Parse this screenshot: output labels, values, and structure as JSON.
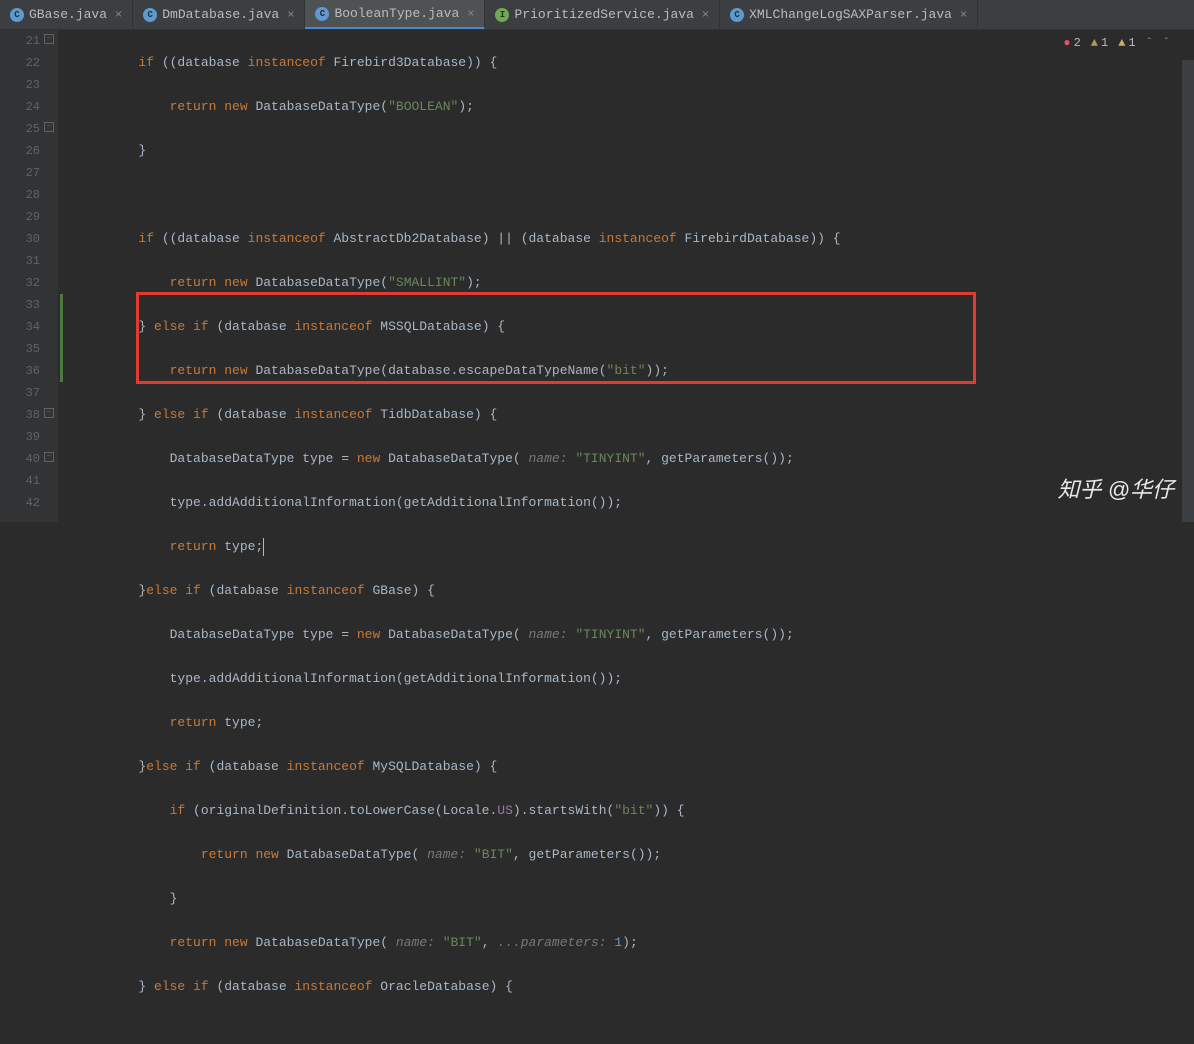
{
  "tabs": [
    {
      "icon": "C",
      "type": "cls",
      "label": "GBase.java",
      "active": false
    },
    {
      "icon": "C",
      "type": "cls",
      "label": "DmDatabase.java",
      "active": false
    },
    {
      "icon": "C",
      "type": "cls",
      "label": "BooleanType.java",
      "active": true
    },
    {
      "icon": "I",
      "type": "intf",
      "label": "PrioritizedService.java",
      "active": false
    },
    {
      "icon": "C",
      "type": "cls",
      "label": "XMLChangeLogSAXParser.java",
      "active": false
    }
  ],
  "lines": [
    {
      "n": "21"
    },
    {
      "n": "22"
    },
    {
      "n": "23"
    },
    {
      "n": "24"
    },
    {
      "n": "25"
    },
    {
      "n": "26"
    },
    {
      "n": "27"
    },
    {
      "n": "28"
    },
    {
      "n": "29"
    },
    {
      "n": "30"
    },
    {
      "n": "31"
    },
    {
      "n": "32"
    },
    {
      "n": "33"
    },
    {
      "n": "34"
    },
    {
      "n": "35"
    },
    {
      "n": "36"
    },
    {
      "n": "37"
    },
    {
      "n": "38"
    },
    {
      "n": "39"
    },
    {
      "n": "40"
    },
    {
      "n": "41"
    },
    {
      "n": "42"
    }
  ],
  "code": {
    "l21a": "        if ((database ",
    "l21kw": "instanceof",
    "l21b": " Firebird3Database)) {",
    "l22a": "            ",
    "l22kw1": "return",
    "l22kw2": " new",
    "l22b": " DatabaseDataType(",
    "l22str": "\"BOOLEAN\"",
    "l22c": ");",
    "l23": "        }",
    "l25a": "        if ((database ",
    "l25kw": "instanceof",
    "l25b": " AbstractDb2Database) || (database ",
    "l25kw2": "instanceof",
    "l25c": " FirebirdDatabase)) {",
    "l26a": "            ",
    "l26kw1": "return",
    "l26kw2": " new",
    "l26b": " DatabaseDataType(",
    "l26str": "\"SMALLINT\"",
    "l26c": ");",
    "l27a": "        } ",
    "l27kw1": "else",
    "l27kw2": " if",
    "l27b": " (database ",
    "l27kw3": "instanceof",
    "l27c": " MSSQLDatabase) {",
    "l28a": "            ",
    "l28kw1": "return",
    "l28kw2": " new",
    "l28b": " DatabaseDataType(database.escapeDataTypeName(",
    "l28str": "\"bit\"",
    "l28c": "));",
    "l29a": "        } ",
    "l29kw1": "else",
    "l29kw2": " if",
    "l29b": " (database ",
    "l29kw3": "instanceof",
    "l29c": " TidbDatabase) {",
    "l30a": "            DatabaseDataType type = ",
    "l30kw": "new",
    "l30b": " DatabaseDataType(",
    "l30hint": " name: ",
    "l30str": "\"TINYINT\"",
    "l30c": ", getParameters());",
    "l31a": "            type.addAdditionalInformation(getAdditionalInformation());",
    "l32a": "            ",
    "l32kw": "return",
    "l32b": " type;",
    "l33a": "        }",
    "l33kw1": "else",
    "l33kw2": " if",
    "l33b": " (database ",
    "l33kw3": "instanceof",
    "l33c": " GBase) {",
    "l34a": "            DatabaseDataType type = ",
    "l34kw": "new",
    "l34b": " DatabaseDataType(",
    "l34hint": " name: ",
    "l34str": "\"TINYINT\"",
    "l34c": ", getParameters());",
    "l35a": "            type.addAdditionalInformation(getAdditionalInformation());",
    "l36a": "            ",
    "l36kw": "return",
    "l36b": " type;",
    "l37a": "        }",
    "l37kw1": "else",
    "l37kw2": " if",
    "l37b": " (database ",
    "l37kw3": "instanceof",
    "l37c": " MySQLDatabase) {",
    "l38a": "            if (originalDefinition.toLowerCase(Locale.",
    "l38fld": "US",
    "l38b": ").startsWith(",
    "l38str": "\"bit\"",
    "l38c": ")) {",
    "l39a": "                ",
    "l39kw1": "return",
    "l39kw2": " new",
    "l39b": " DatabaseDataType(",
    "l39hint": " name: ",
    "l39str": "\"BIT\"",
    "l39c": ", getParameters());",
    "l40": "            }",
    "l41a": "            ",
    "l41kw1": "return",
    "l41kw2": " new",
    "l41b": " DatabaseDataType(",
    "l41hint": " name: ",
    "l41str": "\"BIT\"",
    "l41c": ", ",
    "l41hint2": "...parameters: ",
    "l41num": "1",
    "l41d": ");",
    "l42a": "        } ",
    "l42kw1": "else",
    "l42kw2": " if",
    "l42b": " (database ",
    "l42kw3": "instanceof",
    "l42c": " OracleDatabase) {"
  },
  "inspections": {
    "errors": "2",
    "warnings": "1",
    "weak": "1"
  },
  "watermark": "知乎 @华仔"
}
